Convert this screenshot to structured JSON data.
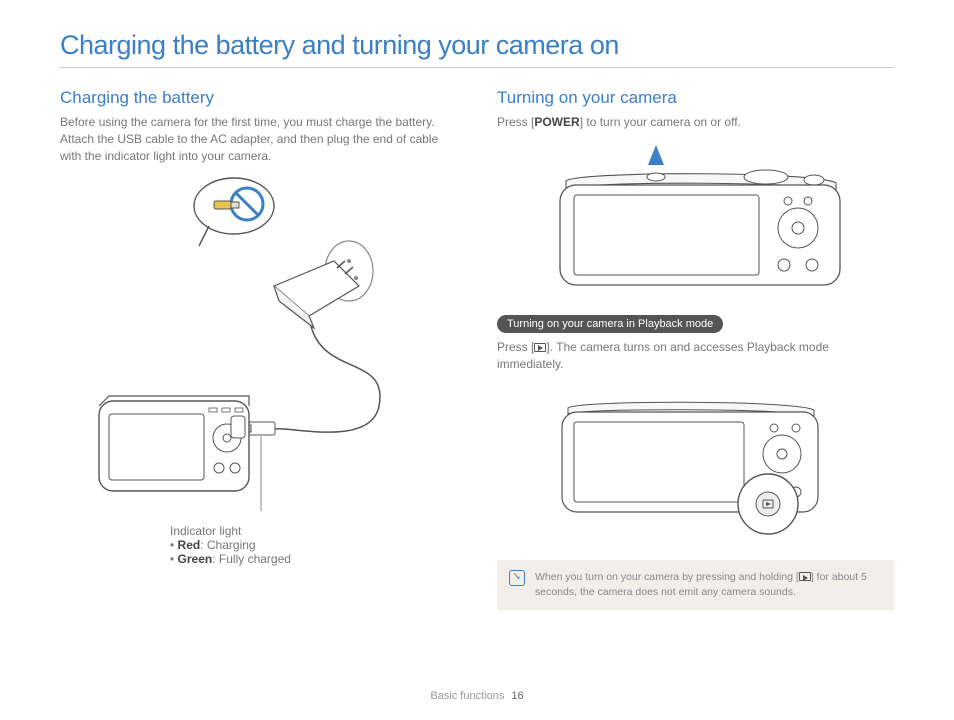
{
  "page": {
    "title": "Charging the battery and turning your camera on",
    "footer_label": "Basic functions",
    "page_number": "16"
  },
  "left": {
    "heading": "Charging the battery",
    "body": "Before using the camera for the first time, you must charge the battery. Attach the USB cable to the AC adapter, and then plug the end of cable with the indicator light into your camera.",
    "indicator": {
      "title": "Indicator light",
      "red_label": "Red",
      "red_desc": ": Charging",
      "green_label": "Green",
      "green_desc": ": Fully charged"
    }
  },
  "right": {
    "heading": "Turning on your camera",
    "body_pre": "Press [",
    "power_label": "POWER",
    "body_post": "] to turn your camera on or off.",
    "pill": "Turning on your camera in Playback mode",
    "playback_pre": "Press [",
    "playback_post": "]. The camera turns on and accesses Playback mode immediately.",
    "note_pre": "When you turn on your camera by pressing and holding [",
    "note_post": "] for about 5 seconds, the camera does not emit any camera sounds."
  }
}
